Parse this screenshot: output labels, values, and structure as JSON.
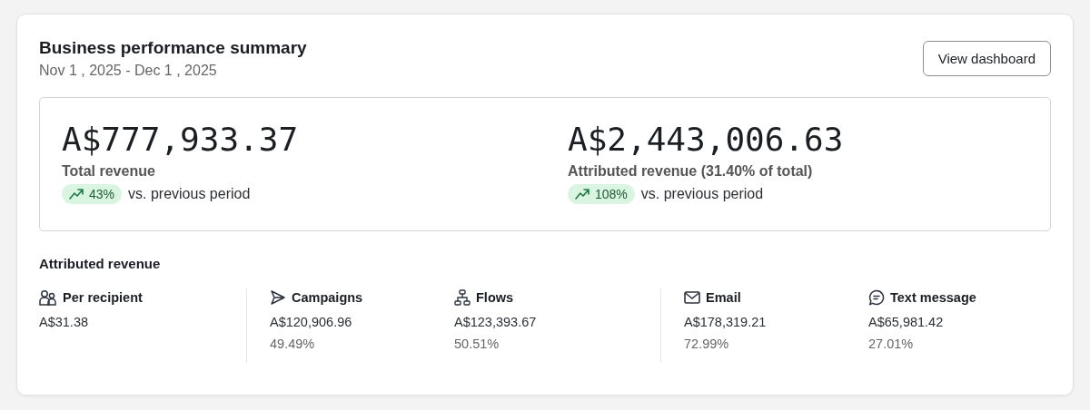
{
  "header": {
    "title": "Business performance summary",
    "date_range": "Nov 1 , 2025 - Dec 1 , 2025",
    "button": "View dashboard"
  },
  "metrics": [
    {
      "value": "A$777,933.37",
      "label": "Total revenue",
      "change": "43%",
      "comparison": "vs. previous period"
    },
    {
      "value": "A$2,443,006.63",
      "label": "Attributed revenue (31.40% of total)",
      "change": "108%",
      "comparison": "vs. previous period"
    }
  ],
  "attributed": {
    "title": "Attributed revenue",
    "groups": [
      {
        "items": [
          {
            "label": "Per recipient",
            "value": "A$31.38"
          }
        ]
      },
      {
        "items": [
          {
            "label": "Campaigns",
            "value": "A$120,906.96",
            "share": "49.49%"
          },
          {
            "label": "Flows",
            "value": "A$123,393.67",
            "share": "50.51%"
          }
        ]
      },
      {
        "items": [
          {
            "label": "Email",
            "value": "A$178,319.21",
            "share": "72.99%"
          },
          {
            "label": "Text message",
            "value": "A$65,981.42",
            "share": "27.01%"
          }
        ]
      }
    ]
  }
}
